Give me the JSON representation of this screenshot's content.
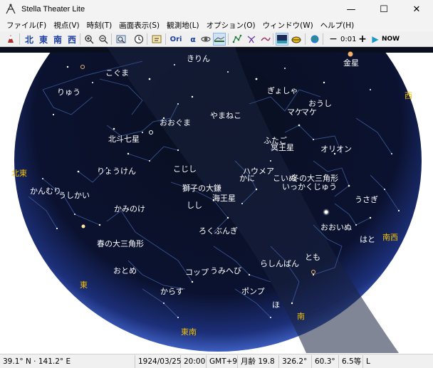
{
  "window": {
    "title": "Stella Theater Lite",
    "minimize": "—",
    "maximize": "☐",
    "close": "✕"
  },
  "menu": [
    "ファイル(F)",
    "視点(V)",
    "時刻(T)",
    "画面表示(S)",
    "観測地(L)",
    "オプション(O)",
    "ウィンドウ(W)",
    "ヘルプ(H)"
  ],
  "toolbar": {
    "north": "北",
    "east": "東",
    "south": "南",
    "west": "西",
    "ori": "Ori",
    "alpha": "α",
    "minus": "−",
    "step": "0:01",
    "plus": "+",
    "play": "▶",
    "now": "NOW"
  },
  "sky": {
    "constellations": [
      "きりん",
      "こぐま",
      "りゅう",
      "ぎょしゃ",
      "おうし",
      "マケ",
      "マケ",
      "やまねこ",
      "おおぐま",
      "北斗七星",
      "ふたご",
      "冥王星",
      "オリオン",
      "りょうけん",
      "こじし",
      "ハウメア",
      "かに",
      "こいぬ",
      "冬の大三角形",
      "いっかくじゅう",
      "獅子の大鎌",
      "かんむり",
      "うしかい",
      "海王星",
      "うさぎ",
      "かみのけ",
      "しし",
      "おおいぬ",
      "ろくぶんぎ",
      "はと",
      "春の大三角形",
      "らしんばん",
      "とも",
      "おとめ",
      "コップ",
      "うみへび",
      "からす",
      "ポンプ",
      "ほ",
      "金星"
    ],
    "directions": [
      "西",
      "北東",
      "南西",
      "東",
      "南",
      "東南"
    ]
  },
  "status": {
    "location": "39.1° N · 141.2° E",
    "date": "1924/03/25",
    "time": "20:00",
    "tz": "GMT+9",
    "moon_age": "月齢 19.8",
    "azimuth": "326.2°",
    "fov": "60.3°",
    "mag": "6.5等",
    "extra": "L"
  }
}
